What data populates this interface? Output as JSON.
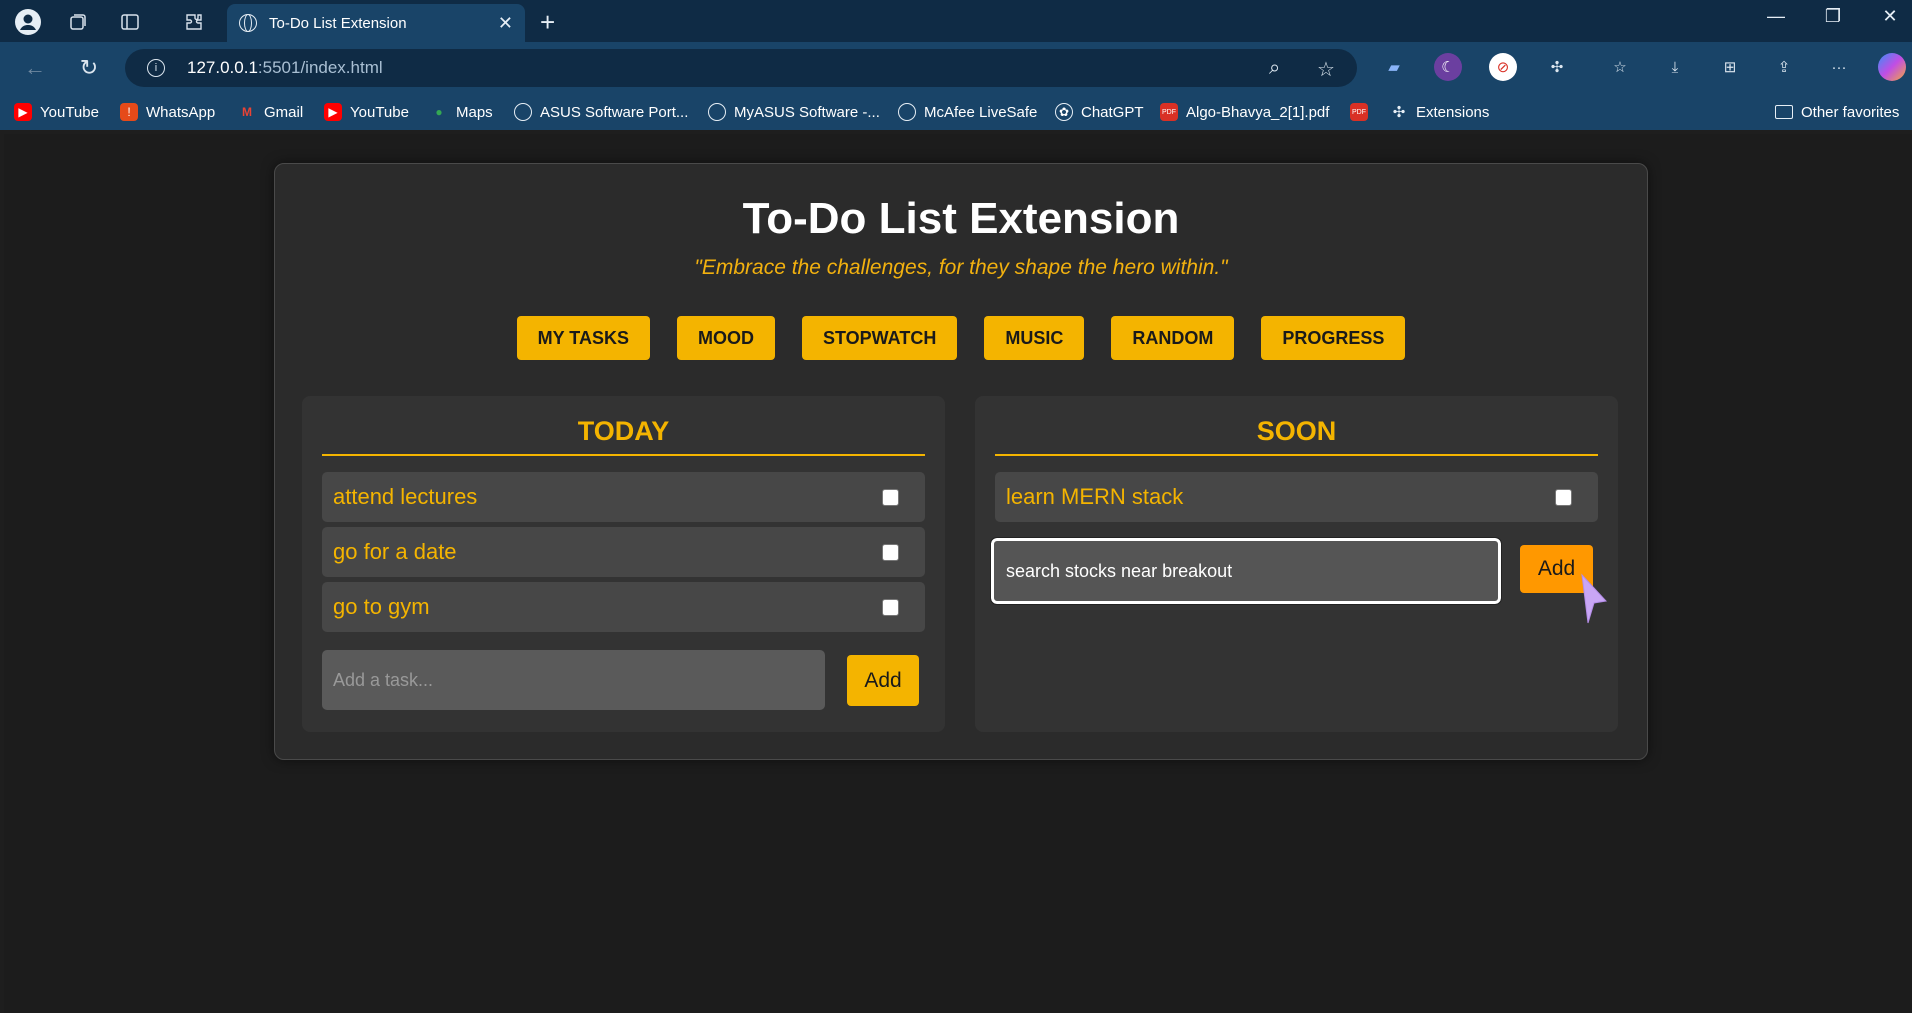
{
  "browser": {
    "tab_title": "To-Do List Extension",
    "url_host": "127.0.0.1",
    "url_path": ":5501/index.html",
    "bookmarks": [
      "YouTube",
      "WhatsApp",
      "Gmail",
      "YouTube",
      "Maps",
      "ASUS Software Port...",
      "MyASUS Software -...",
      "McAfee LiveSafe",
      "ChatGPT",
      "Algo-Bhavya_2[1].pdf",
      "Extensions"
    ],
    "other_favorites": "Other favorites"
  },
  "page": {
    "title": "To-Do List Extension",
    "quote": "\"Embrace the challenges, for they shape the hero within.\"",
    "nav": [
      "MY TASKS",
      "MOOD",
      "STOPWATCH",
      "MUSIC",
      "RANDOM",
      "PROGRESS"
    ],
    "today": {
      "title": "TODAY",
      "tasks": [
        "attend lectures",
        "go for a date",
        "go to gym"
      ],
      "input_placeholder": "Add a task...",
      "add_label": "Add"
    },
    "soon": {
      "title": "SOON",
      "tasks": [
        "learn MERN stack"
      ],
      "input_value": "search stocks near breakout",
      "add_label": "Add"
    }
  },
  "colors": {
    "accent": "#f4b400",
    "add_hover": "#ff9800",
    "background": "#1c1c1c",
    "card": "#2b2b2b"
  }
}
